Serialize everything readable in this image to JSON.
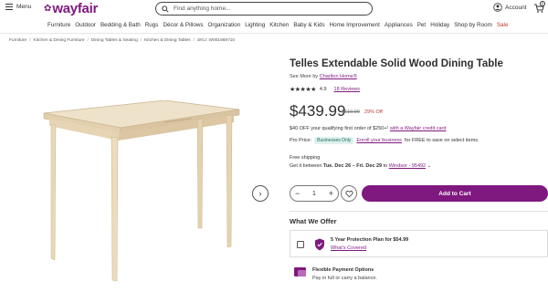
{
  "header": {
    "menu_label": "Menu",
    "logo_text": "wayfair",
    "search_placeholder": "Find anything home...",
    "account_label": "Account",
    "cart_count": "0"
  },
  "categories": [
    "Furniture",
    "Outdoor",
    "Bedding & Bath",
    "Rugs",
    "Décor & Pillows",
    "Organization",
    "Lighting",
    "Kitchen",
    "Baby & Kids",
    "Home Improvement",
    "Appliances",
    "Pet",
    "Holiday",
    "Shop by Room",
    "Sale"
  ],
  "breadcrumb": [
    "Furniture",
    "Kitchen & Dining Furniture",
    "Dining Tables & Seating",
    "Kitchen & Dining Tables",
    "SKU: W001668710"
  ],
  "product": {
    "title": "Telles Extendable Solid Wood Dining Table",
    "see_more_prefix": "See More by",
    "brand": "Charlton Home®",
    "rating_value": 4.9,
    "rating_text": "4.9",
    "reviews": "18 Reviews",
    "price": "$439.99",
    "was_price": "$619.99",
    "discount": "29% Off",
    "credit_offer_prefix": "$40 OFF your qualifying first order of $250+¹",
    "credit_offer_link": "with a Wayfair credit card",
    "pro_price_label": "Pro Price:",
    "pro_badge": "Businesses Only",
    "pro_enroll_link": "Enroll your business",
    "pro_suffix": "for FREE to save on select items.",
    "shipping_label": "Free shipping",
    "delivery_prefix": "Get it between",
    "delivery_dates": "Tue. Dec 26 – Fri. Dec 29",
    "delivery_to": "to",
    "delivery_location": "Windsor - 95492"
  },
  "purchase": {
    "quantity": "1",
    "add_to_cart": "Add to Cart"
  },
  "offers": {
    "heading": "What We Offer",
    "plan_title": "5 Year Protection Plan for $54.99",
    "plan_link": "What's Covered",
    "flex_title": "Flexible Payment Options",
    "flex_sub": "Pay in full or carry a balance."
  },
  "colors": {
    "brand": "#7f187f",
    "sale": "#c0392b",
    "wood": "#ead9bd"
  }
}
